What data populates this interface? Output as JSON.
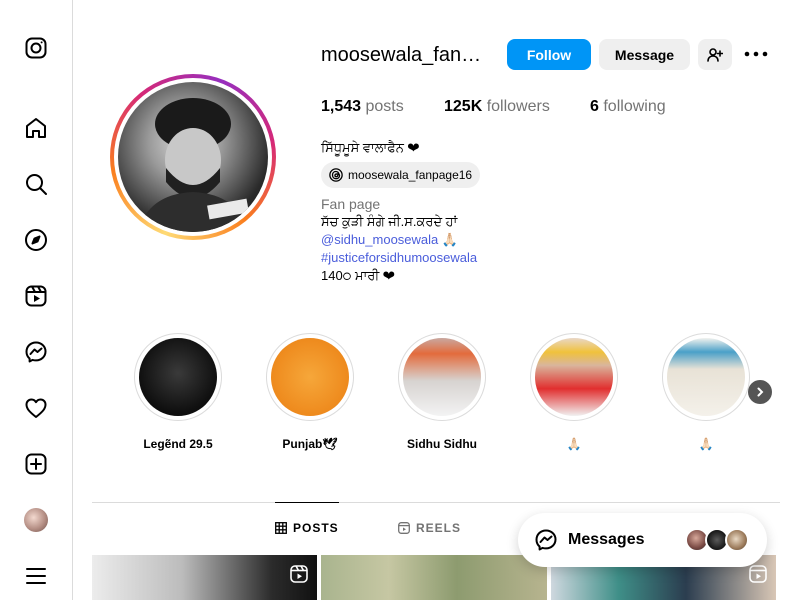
{
  "nav": {
    "items": [
      {
        "name": "instagram-logo-icon"
      },
      {
        "name": "home-icon",
        "label": "Home"
      },
      {
        "name": "search-icon",
        "label": "Search"
      },
      {
        "name": "explore-icon",
        "label": "Explore"
      },
      {
        "name": "reels-icon",
        "label": "Reels"
      },
      {
        "name": "messenger-icon",
        "label": "Messages"
      },
      {
        "name": "heart-icon",
        "label": "Notifications"
      },
      {
        "name": "create-icon",
        "label": "Create"
      },
      {
        "name": "profile-avatar",
        "label": "Profile"
      },
      {
        "name": "menu-icon",
        "label": "More"
      }
    ]
  },
  "profile": {
    "username": "moosewala_fan…",
    "follow_label": "Follow",
    "message_label": "Message",
    "stats": {
      "posts_count": "1,543",
      "posts_label": "posts",
      "followers_count": "125K",
      "followers_label": "followers",
      "following_count": "6",
      "following_label": "following"
    },
    "display_name": "ਸਿੱਧੂਮੂਸੇ ਵਾਲਾਫੈਨ ❤",
    "threads_handle": "moosewala_fanpage16",
    "category": "Fan page",
    "bio_line1": "ਸੱਚ ਕੁੜੀ ਸੰਗੇ ਜੀ.ਸ.ਕਰਦੇ ਹਾਂ",
    "bio_mention": "@sidhu_moosewala",
    "bio_mention_suffix": " 🙏🏻",
    "bio_hashtag": "#justiceforsidhumoosewala",
    "bio_line4": "140੦ ਮਾਰੀ ❤"
  },
  "highlights": [
    {
      "label": "Legẽnd 29.5"
    },
    {
      "label": "Punjab🕊"
    },
    {
      "label": "Sidhu Sidhu"
    },
    {
      "label": "🙏🏻"
    },
    {
      "label": "🙏🏻"
    }
  ],
  "tabs": {
    "posts_label": "POSTS",
    "reels_label": "REELS"
  },
  "messages": {
    "label": "Messages"
  },
  "colors": {
    "accent": "#0095f6",
    "link": "#4a5ddb",
    "border": "#dbdbdb",
    "button_gray": "#efefef"
  }
}
